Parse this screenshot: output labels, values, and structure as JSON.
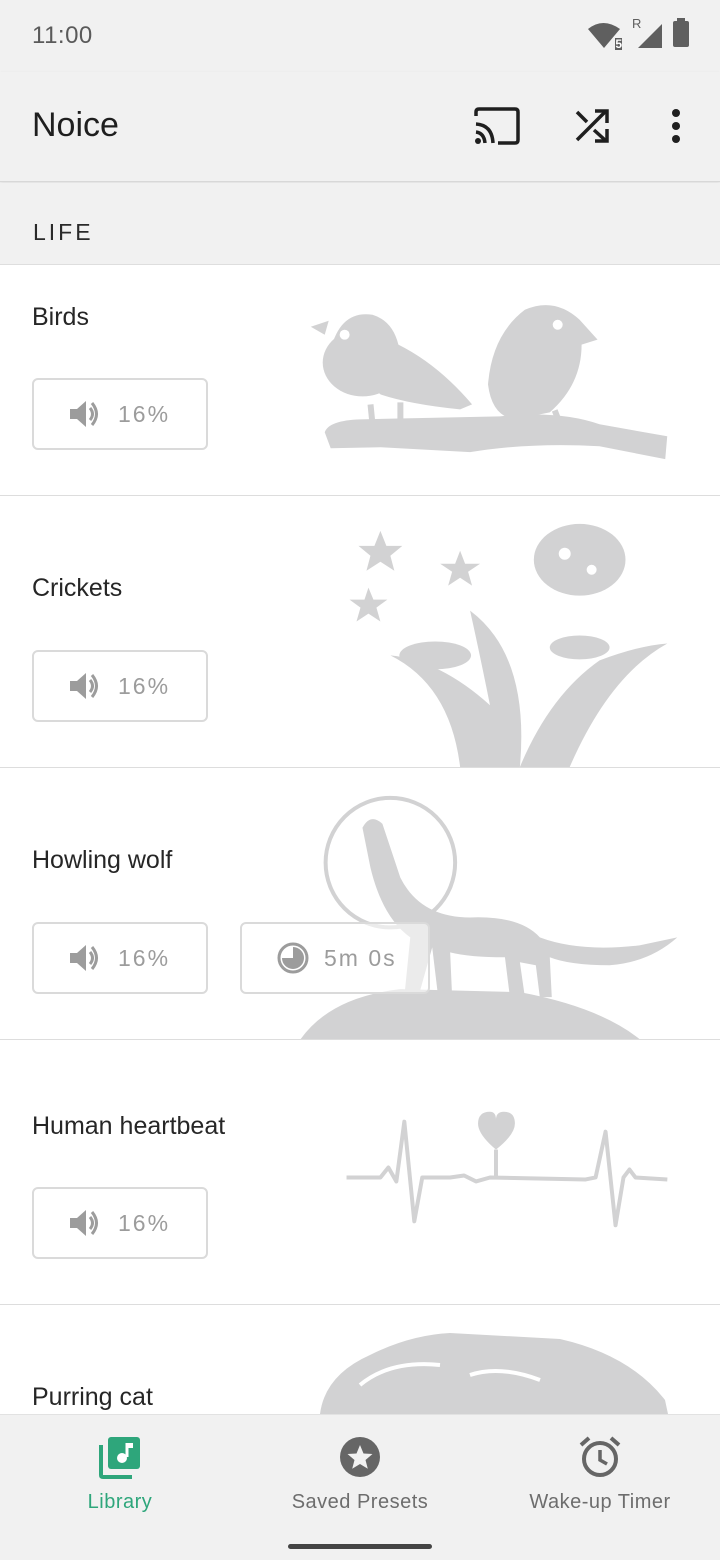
{
  "status_bar": {
    "time": "11:00",
    "icons": [
      "wifi-icon",
      "signal-icon",
      "battery-icon"
    ],
    "wifi_badge": "5",
    "roaming_badge": "R"
  },
  "app_bar": {
    "title": "Noice",
    "actions": [
      "cast-icon",
      "shuffle-icon",
      "more-vert-icon"
    ]
  },
  "section": {
    "label": "LIFE"
  },
  "sounds": [
    {
      "name": "Birds",
      "volume": "16%"
    },
    {
      "name": "Crickets",
      "volume": "16%"
    },
    {
      "name": "Howling wolf",
      "volume": "16%",
      "timer": "5m 0s"
    },
    {
      "name": "Human heartbeat",
      "volume": "16%"
    },
    {
      "name": "Purring cat"
    }
  ],
  "bottom_nav": {
    "items": [
      {
        "label": "Library",
        "icon": "library-music-icon",
        "active": true
      },
      {
        "label": "Saved Presets",
        "icon": "star-icon",
        "active": false
      },
      {
        "label": "Wake-up Timer",
        "icon": "alarm-icon",
        "active": false
      }
    ]
  },
  "colors": {
    "accent": "#2ea67b",
    "art_gray": "#d2d2d3",
    "background": "#f1f1f1"
  }
}
